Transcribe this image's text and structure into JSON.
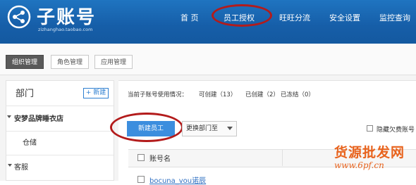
{
  "header": {
    "logo_title": "子账号",
    "logo_subtitle": "zizhanghao.taobao.com",
    "nav": [
      "首 页",
      "员工授权",
      "旺旺分流",
      "安全设置",
      "监控查询"
    ]
  },
  "tabs": [
    "组织管理",
    "角色管理",
    "应用管理"
  ],
  "left": {
    "title": "部门",
    "new_button": "+ 新建",
    "tree": {
      "root": "安梦品牌睡衣店",
      "child1": "仓储",
      "child2": "客服"
    }
  },
  "main": {
    "usage_prefix": "当前子账号使用情况：",
    "usage_creatable": "可创建（13）",
    "usage_created": "已创建（2）",
    "usage_frozen": "已冻结（0）",
    "new_employee_button": "新建员工",
    "change_dept_button": "更换部门至",
    "hide_arrears_label": "隐藏欠费账号",
    "table": {
      "col_account": "账号名",
      "first_row_partial": "bocuna_vou诺辰"
    }
  },
  "watermark": {
    "title": "货源批发网",
    "url": "www.6pf.cn"
  },
  "colors": {
    "header_blue": "#1a66b3",
    "primary_button": "#3c8ede",
    "annotation_red": "#b31b1b",
    "watermark_orange": "#e8631d"
  },
  "icons": [
    "share-network-icon",
    "chevron-down-icon",
    "tree-expand-icon",
    "tree-collapse-icon"
  ]
}
